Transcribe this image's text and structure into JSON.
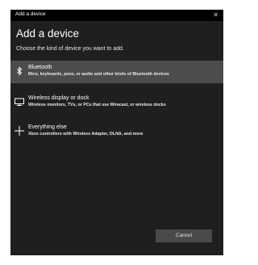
{
  "window": {
    "title": "Add a device",
    "close_glyph": "✕"
  },
  "header": {
    "heading": "Add a device",
    "subheading": "Choose the kind of device you want to add."
  },
  "options": [
    {
      "icon": "bluetooth-icon",
      "title": "Bluetooth",
      "description": "Mice, keyboards, pens, or audio and other kinds of Bluetooth devices",
      "selected": true
    },
    {
      "icon": "monitor-icon",
      "title": "Wireless display or dock",
      "description": "Wireless monitors, TVs, or PCs that use Miracast, or wireless docks",
      "selected": false
    },
    {
      "icon": "plus-icon",
      "title": "Everything else",
      "description": "Xbox controllers with Wireless Adapter, DLNA, and more",
      "selected": false
    }
  ],
  "footer": {
    "cancel_label": "Cancel"
  },
  "colors": {
    "window_bg": "#1f1f1f",
    "titlebar_bg": "#000000",
    "selected_bg": "#4c4c4c",
    "button_bg": "#4a4a4a"
  }
}
